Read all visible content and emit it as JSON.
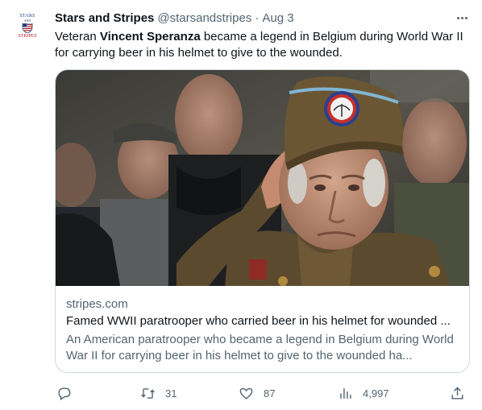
{
  "account": {
    "avatar_top": "STARS",
    "avatar_mid": "AND",
    "avatar_bottom": "STRIPES",
    "name": "Stars and Stripes",
    "handle": "@starsandstripes",
    "separator": "·",
    "date": "Aug 3"
  },
  "tweet": {
    "text_before": "Veteran ",
    "text_bold": "Vincent Speranza",
    "text_after": " became a legend in Belgium during World War II for carrying beer in his helmet to give to the wounded."
  },
  "card": {
    "domain": "stripes.com",
    "title": "Famed WWII paratrooper who carried beer in his helmet for wounded ...",
    "description": "An American paratrooper who became a legend in Belgium during World War II for carrying beer in his helmet to give to the wounded ha..."
  },
  "actions": {
    "reply_count": "",
    "retweet_count": "31",
    "like_count": "87",
    "views_count": "4,997"
  },
  "colors": {
    "text": "#0f1419",
    "secondary": "#536471",
    "border": "#cfd9de"
  }
}
